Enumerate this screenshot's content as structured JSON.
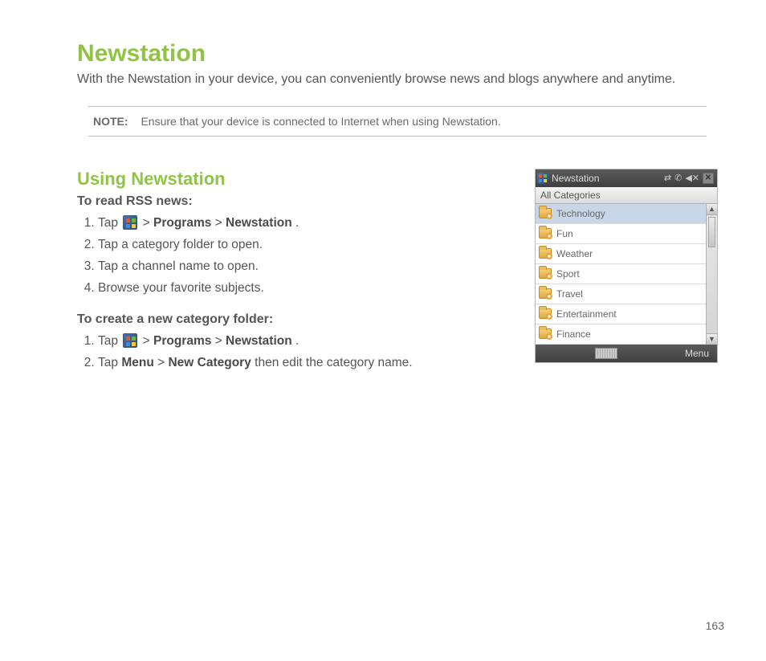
{
  "heading": "Newstation",
  "intro": "With the Newstation in your device, you can conveniently browse news and blogs anywhere and anytime.",
  "note": {
    "label": "NOTE:",
    "text": "Ensure that your device is connected to Internet when using Newstation."
  },
  "section_heading": "Using Newstation",
  "task_read": {
    "title": "To read RSS news:",
    "steps": {
      "s1a": "Tap ",
      "s1b": " > ",
      "s1_kw1": "Programs",
      "s1c": " > ",
      "s1_kw2": "Newstation",
      "s1d": ".",
      "s2": "Tap a category folder to open.",
      "s3": "Tap a channel name to open.",
      "s4": "Browse your favorite subjects."
    }
  },
  "task_create": {
    "title": "To create a new category folder:",
    "steps": {
      "s1a": "Tap ",
      "s1b": " > ",
      "s1_kw1": "Programs",
      "s1c": " > ",
      "s1_kw2": "Newstation",
      "s1d": ".",
      "s2a": "Tap ",
      "s2_kw1": "Menu",
      "s2b": " > ",
      "s2_kw2": "New Category",
      "s2c": " then edit the category name."
    }
  },
  "device": {
    "title": "Newstation",
    "status_glyphs": "⇄ ⌂ ◀✕",
    "close": "✕",
    "category_header": "All Categories",
    "items": [
      "Technology",
      "Fun",
      "Weather",
      "Sport",
      "Travel",
      "Entertainment",
      "Finance"
    ],
    "menu_label": "Menu"
  },
  "page_number": "163"
}
